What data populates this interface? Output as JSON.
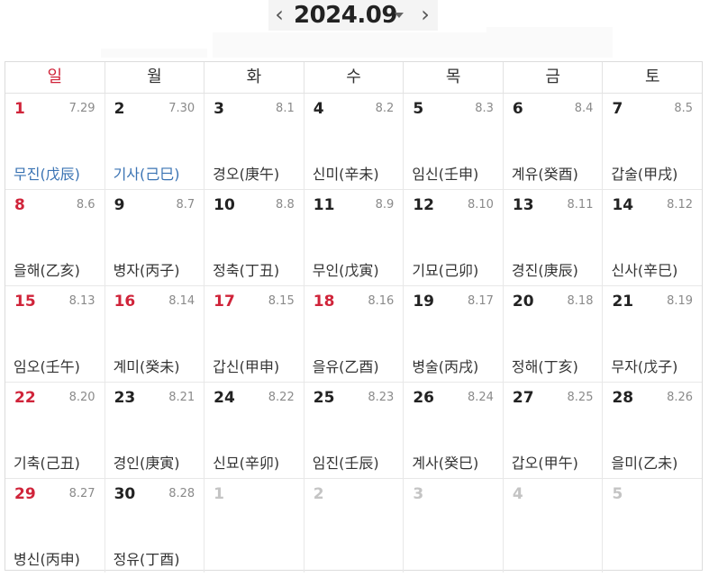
{
  "header": {
    "month": "2024.09",
    "prev_icon": "‹",
    "next_icon": "›"
  },
  "weekdays": [
    "일",
    "월",
    "화",
    "수",
    "목",
    "금",
    "토"
  ],
  "weeks": [
    [
      {
        "day": "1",
        "lunar": "7.29",
        "ganji": "무진(戊辰)",
        "color": "red",
        "ganji_color": "blue"
      },
      {
        "day": "2",
        "lunar": "7.30",
        "ganji": "기사(己巳)",
        "color": "",
        "ganji_color": "blue"
      },
      {
        "day": "3",
        "lunar": "8.1",
        "ganji": "경오(庚午)",
        "color": ""
      },
      {
        "day": "4",
        "lunar": "8.2",
        "ganji": "신미(辛未)",
        "color": ""
      },
      {
        "day": "5",
        "lunar": "8.3",
        "ganji": "임신(壬申)",
        "color": ""
      },
      {
        "day": "6",
        "lunar": "8.4",
        "ganji": "계유(癸酉)",
        "color": ""
      },
      {
        "day": "7",
        "lunar": "8.5",
        "ganji": "갑술(甲戌)",
        "color": ""
      }
    ],
    [
      {
        "day": "8",
        "lunar": "8.6",
        "ganji": "을해(乙亥)",
        "color": "red"
      },
      {
        "day": "9",
        "lunar": "8.7",
        "ganji": "병자(丙子)",
        "color": ""
      },
      {
        "day": "10",
        "lunar": "8.8",
        "ganji": "정축(丁丑)",
        "color": ""
      },
      {
        "day": "11",
        "lunar": "8.9",
        "ganji": "무인(戊寅)",
        "color": ""
      },
      {
        "day": "12",
        "lunar": "8.10",
        "ganji": "기묘(己卯)",
        "color": ""
      },
      {
        "day": "13",
        "lunar": "8.11",
        "ganji": "경진(庚辰)",
        "color": ""
      },
      {
        "day": "14",
        "lunar": "8.12",
        "ganji": "신사(辛巳)",
        "color": ""
      }
    ],
    [
      {
        "day": "15",
        "lunar": "8.13",
        "ganji": "임오(壬午)",
        "color": "red"
      },
      {
        "day": "16",
        "lunar": "8.14",
        "ganji": "계미(癸未)",
        "color": "red"
      },
      {
        "day": "17",
        "lunar": "8.15",
        "ganji": "갑신(甲申)",
        "color": "red"
      },
      {
        "day": "18",
        "lunar": "8.16",
        "ganji": "을유(乙酉)",
        "color": "red"
      },
      {
        "day": "19",
        "lunar": "8.17",
        "ganji": "병술(丙戌)",
        "color": ""
      },
      {
        "day": "20",
        "lunar": "8.18",
        "ganji": "정해(丁亥)",
        "color": ""
      },
      {
        "day": "21",
        "lunar": "8.19",
        "ganji": "무자(戊子)",
        "color": ""
      }
    ],
    [
      {
        "day": "22",
        "lunar": "8.20",
        "ganji": "기축(己丑)",
        "color": "red"
      },
      {
        "day": "23",
        "lunar": "8.21",
        "ganji": "경인(庚寅)",
        "color": ""
      },
      {
        "day": "24",
        "lunar": "8.22",
        "ganji": "신묘(辛卯)",
        "color": ""
      },
      {
        "day": "25",
        "lunar": "8.23",
        "ganji": "임진(壬辰)",
        "color": ""
      },
      {
        "day": "26",
        "lunar": "8.24",
        "ganji": "계사(癸巳)",
        "color": ""
      },
      {
        "day": "27",
        "lunar": "8.25",
        "ganji": "갑오(甲午)",
        "color": ""
      },
      {
        "day": "28",
        "lunar": "8.26",
        "ganji": "을미(乙未)",
        "color": ""
      }
    ],
    [
      {
        "day": "29",
        "lunar": "8.27",
        "ganji": "병신(丙申)",
        "color": "red"
      },
      {
        "day": "30",
        "lunar": "8.28",
        "ganji": "정유(丁酉)",
        "color": ""
      },
      {
        "day": "1",
        "lunar": "",
        "ganji": "",
        "color": "muted"
      },
      {
        "day": "2",
        "lunar": "",
        "ganji": "",
        "color": "muted"
      },
      {
        "day": "3",
        "lunar": "",
        "ganji": "",
        "color": "muted"
      },
      {
        "day": "4",
        "lunar": "",
        "ganji": "",
        "color": "muted"
      },
      {
        "day": "5",
        "lunar": "",
        "ganji": "",
        "color": "muted"
      }
    ]
  ]
}
